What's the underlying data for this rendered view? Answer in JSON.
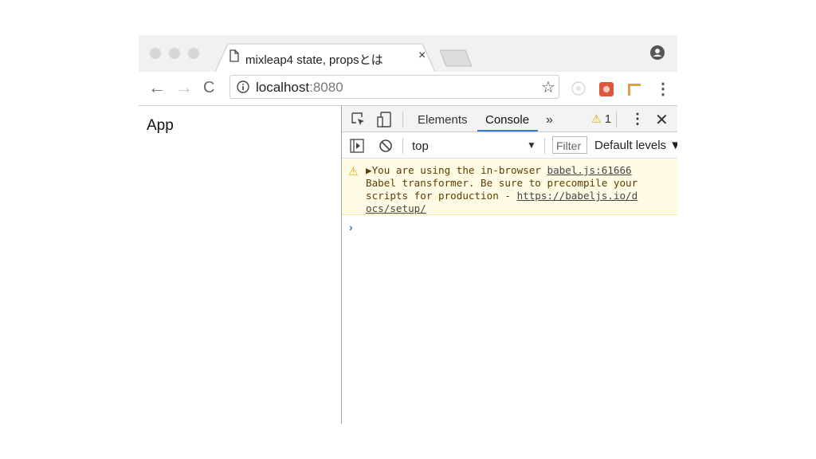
{
  "tab": {
    "title": "mixleap4 state, propsとは",
    "close": "×"
  },
  "toolbar": {
    "back": "←",
    "forward": "→",
    "reload": "C",
    "url_host": "localhost",
    "url_port": ":8080",
    "bookmark": "☆",
    "menu": "⋮"
  },
  "page": {
    "text": "App"
  },
  "devtools": {
    "tabs": [
      "Elements",
      "Console"
    ],
    "more_tabs": "»",
    "active_tab": "Console",
    "warning_count": "1",
    "menu": "⋮",
    "close": "✕",
    "context": "top",
    "filter_placeholder": "Filter",
    "levels": "Default levels ▼",
    "warning": {
      "line1": "You are using the in-browser ",
      "link1": "babel.js:61666",
      "line2": "Babel transformer. Be sure to precompile your",
      "line3": "scripts for production - ",
      "link2a": "https://babeljs.io/d",
      "link2b": "ocs/setup/"
    },
    "prompt": "›"
  },
  "colors": {
    "accent": "#3879d9",
    "warning_bg": "#fffbe5",
    "warning_icon": "#f0a500"
  },
  "icons": [
    "file-icon",
    "profile-icon",
    "info-icon",
    "inspect-icon",
    "device-icon",
    "sidebar-icon",
    "clear-icon",
    "warning-icon"
  ]
}
